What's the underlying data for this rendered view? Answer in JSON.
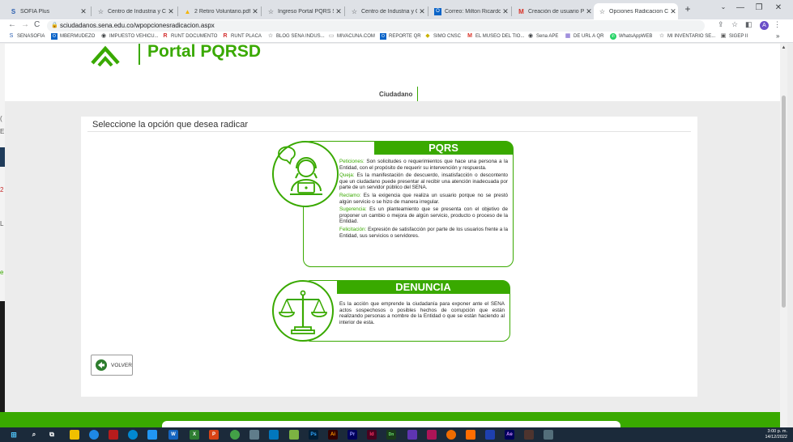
{
  "browser": {
    "tabs": [
      {
        "label": "SOFIA Plus",
        "icon": "sofia-icon",
        "active": false
      },
      {
        "label": "Centro de Industria y Cons",
        "icon": "star-icon",
        "active": false
      },
      {
        "label": "2 Retiro Voluntario.pdf",
        "icon": "drive-icon",
        "active": false
      },
      {
        "label": "Ingreso Portal PQRS Sena",
        "icon": "star-icon",
        "active": false
      },
      {
        "label": "Centro de Industria y Cons",
        "icon": "star-icon",
        "active": false
      },
      {
        "label": "Correo: Milton Ricardo Bo",
        "icon": "outlook-icon",
        "active": false
      },
      {
        "label": "Creación de usuario PQRS",
        "icon": "gmail-icon",
        "active": false
      },
      {
        "label": "Opciones Radicacion Ciud",
        "icon": "star-icon",
        "active": true
      }
    ],
    "new_tab": "+",
    "window_controls": {
      "minimize": "—",
      "maximize": "❐",
      "close": "✕"
    },
    "url": "sciudadanos.sena.edu.co/wpopcionesradicacion.aspx",
    "profile_initial": "A",
    "bookmarks": [
      {
        "label": "SENASOFIA",
        "icon": "sofia-icon"
      },
      {
        "label": "MBERMUDEZO",
        "icon": "outlook-icon"
      },
      {
        "label": "IMPUESTO VEHICU...",
        "icon": "globe-icon"
      },
      {
        "label": "RUNT DOCUMENTO",
        "icon": "runt-icon"
      },
      {
        "label": "RUNT PLACA",
        "icon": "runt-icon"
      },
      {
        "label": "BLOG SENA INDUS...",
        "icon": "star-icon"
      },
      {
        "label": "MIVACUNA.COM",
        "icon": "vac-icon"
      },
      {
        "label": "REPORTE QR",
        "icon": "outlook-icon"
      },
      {
        "label": "SIMO CNSC",
        "icon": "leaf-icon"
      },
      {
        "label": "EL MUSEO DEL TIO...",
        "icon": "gmail-icon"
      },
      {
        "label": "Sena APE",
        "icon": "globe-icon"
      },
      {
        "label": "DE URL A QR",
        "icon": "qr-icon"
      },
      {
        "label": "WhatsAppWEB",
        "icon": "whatsapp-icon"
      },
      {
        "label": "MI INVENTARIO SE...",
        "icon": "star-icon"
      },
      {
        "label": "SIGEP II",
        "icon": "sigep-icon"
      }
    ],
    "bookmarks_more": "»"
  },
  "page": {
    "portal_title": "Portal PQRSD",
    "role_tab": "Ciudadano",
    "prompt": "Seleccione la opción que desea radicar",
    "pqrs": {
      "title": "PQRS",
      "items": [
        {
          "key": "Peticiones:",
          "text": "Son solicitudes o requerimientos que hace una persona a la Entidad, con el propósito de requerir su intervención y respuesta."
        },
        {
          "key": "Queja:",
          "text": "Es la manifestación de descuerdo, insatisfacción o descontento que un ciudadano puede presentar al recibir una atención inadecuada por parte de un servidor público del SENA."
        },
        {
          "key": "Reclamo:",
          "text": "Es la exigencia que realiza un usuario porque no se prestó algún servicio o se hizo de manera irregular."
        },
        {
          "key": "Sugerencia:",
          "text": "Es un planteamiento que se presenta con el objetivo de proponer un cambio o mejora de algún servicio, producto o proceso de la Entidad."
        },
        {
          "key": "Felicitación:",
          "text": "Expresión de satisfacción por parte de los usuarios frente a la Entidad, sus servicios o servidores."
        }
      ]
    },
    "denuncia": {
      "title": "DENUNCIA",
      "text": "Es la acción que emprende la ciudadanía para exponer ante el SENA actos sospechosos o posibles hechos de corrupción que están realizando personas a nombre de la Entidad o que se están haciendo al interior de esta."
    },
    "back_button": "VOLVER"
  },
  "taskbar": {
    "time": "3:00 p. m.",
    "date": "14/12/2022",
    "apps": [
      "Ps",
      "Ai",
      "Pr",
      "Id",
      "Dn",
      "Ae"
    ]
  },
  "colors": {
    "brand_green": "#39a900",
    "taskbar": "#1b2a3a"
  }
}
